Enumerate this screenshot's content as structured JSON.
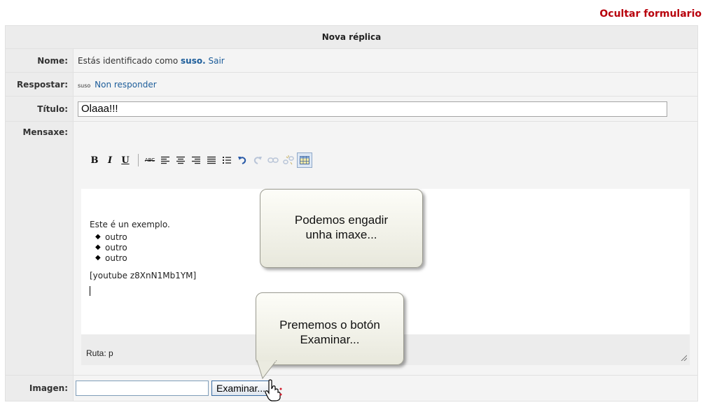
{
  "header": {
    "hide_form_link": "Ocultar formulario",
    "form_title": "Nova réplica"
  },
  "rows": {
    "name": {
      "label": "Nome:",
      "text": "Estás identificado como",
      "user": "suso.",
      "logout": "Sair"
    },
    "reply": {
      "label": "Respostar:",
      "user_small": "suso",
      "no_reply": "Non responder"
    },
    "title": {
      "label": "Título:",
      "value": "Olaaa!!!"
    },
    "message": {
      "label": "Mensaxe:"
    },
    "image": {
      "label": "Imagen:",
      "browse_button": "Examinar..."
    }
  },
  "toolbar": {
    "buttons": [
      {
        "name": "bold-button",
        "glyph": "B"
      },
      {
        "name": "italic-button",
        "glyph": "I"
      },
      {
        "name": "underline-button",
        "glyph": "U"
      },
      {
        "name": "strikethrough-button",
        "glyph": "ABC"
      },
      {
        "name": "align-left-button",
        "icon": "align-left-icon"
      },
      {
        "name": "align-center-button",
        "icon": "align-center-icon"
      },
      {
        "name": "align-right-button",
        "icon": "align-right-icon"
      },
      {
        "name": "align-justify-button",
        "icon": "align-justify-icon"
      },
      {
        "name": "bullet-list-button",
        "icon": "bullet-list-icon"
      },
      {
        "name": "undo-button",
        "icon": "undo-icon"
      },
      {
        "name": "redo-button",
        "icon": "redo-icon"
      },
      {
        "name": "link-button",
        "icon": "link-icon"
      },
      {
        "name": "unlink-button",
        "icon": "unlink-icon"
      },
      {
        "name": "insert-table-button",
        "icon": "table-icon"
      }
    ]
  },
  "editor": {
    "paragraph": "Este é un exemplo.",
    "list_items": [
      "outro",
      "outro",
      "outro"
    ],
    "embed": "[youtube z8XnN1Mb1YM]",
    "path_label": "Ruta: p"
  },
  "callouts": {
    "first": {
      "line1": "Podemos engadir",
      "line2": "unha imaxe..."
    },
    "second": {
      "line1": "Prememos o botón",
      "line2": "Examinar..."
    }
  },
  "colors": {
    "hide_link": "#b8000c",
    "link": "#1d5d9a",
    "row_bg": "#f4f4f4",
    "label_bg": "#ececec"
  }
}
